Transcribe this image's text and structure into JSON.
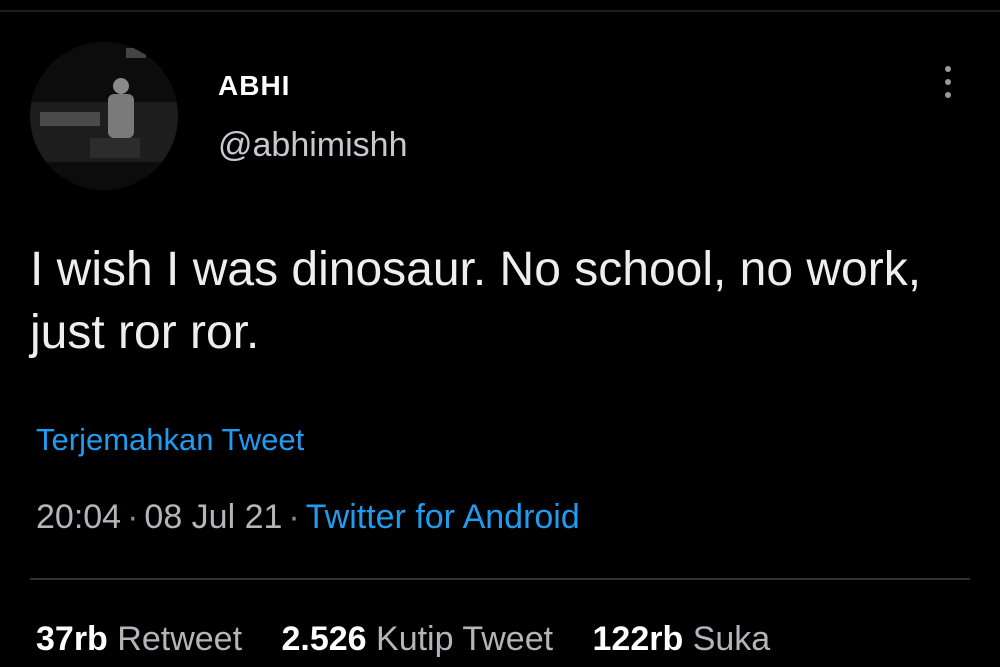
{
  "tweet": {
    "author": {
      "display_name": "ABHI",
      "handle": "@abhimishh"
    },
    "text": "I wish I was dinosaur. No school, no work, just ror ror.",
    "translate_label": "Terjemahkan Tweet",
    "time": "20:04",
    "date": "08 Jul 21",
    "separator": "·",
    "source": "Twitter for Android",
    "stats": {
      "retweets_count": "37rb",
      "retweets_label": "Retweet",
      "quotes_count": "2.526",
      "quotes_label": "Kutip Tweet",
      "likes_count": "122rb",
      "likes_label": "Suka"
    }
  },
  "icons": {
    "more": "more-vertical-icon"
  },
  "colors": {
    "background": "#000000",
    "link": "#1f9bf0",
    "secondary_text": "#b3b5b8",
    "divider": "#2f3336"
  }
}
